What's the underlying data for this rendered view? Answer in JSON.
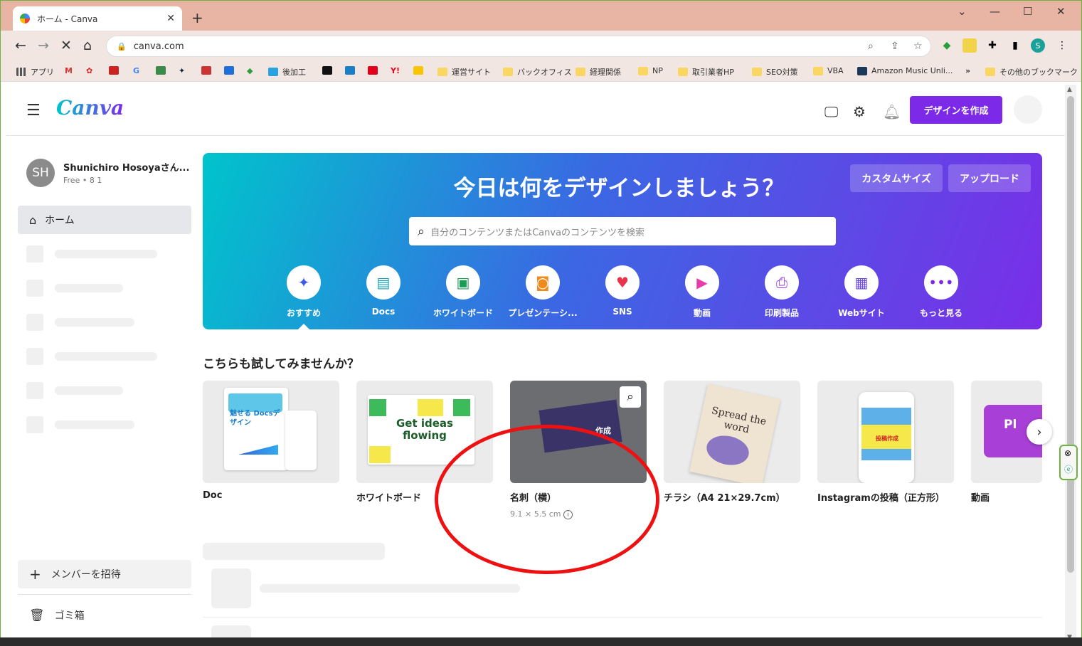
{
  "browser": {
    "tab_title": "ホーム - Canva",
    "url": "canva.com",
    "bookmarks": [
      {
        "label": "アプリ"
      },
      {
        "label": "後加工"
      },
      {
        "label": "運営サイト"
      },
      {
        "label": "バックオフィス"
      },
      {
        "label": "経理関係"
      },
      {
        "label": "NP"
      },
      {
        "label": "取引業者HP"
      },
      {
        "label": "SEO対策"
      },
      {
        "label": "VBA"
      },
      {
        "label": "Amazon Music Unli..."
      },
      {
        "label": "その他のブックマーク"
      }
    ],
    "profile_initial": "S"
  },
  "header": {
    "logo": "Canva",
    "create_button": "デザインを作成"
  },
  "sidebar": {
    "avatar_initials": "SH",
    "user_name": "Shunichiro Hosoyaさん...",
    "plan": "Free • 8 1",
    "home": "ホーム",
    "invite": "メンバーを招待",
    "trash": "ゴミ箱"
  },
  "hero": {
    "title": "今日は何をデザインしましょう？",
    "custom_size": "カスタムサイズ",
    "upload": "アップロード",
    "search_placeholder": "自分のコンテンツまたはCanvaのコンテンツを検索",
    "categories": [
      {
        "label": "おすすめ",
        "icon": "sparkle-icon",
        "color": "#3b5ce5"
      },
      {
        "label": "Docs",
        "icon": "docs-icon",
        "color": "#13a3b8"
      },
      {
        "label": "ホワイトボード",
        "icon": "whiteboard-icon",
        "color": "#1a9e55"
      },
      {
        "label": "プレゼンテーシ...",
        "icon": "presentation-icon",
        "color": "#f08a1c"
      },
      {
        "label": "SNS",
        "icon": "heart-icon",
        "color": "#e8344a"
      },
      {
        "label": "動画",
        "icon": "video-icon",
        "color": "#e83aa8"
      },
      {
        "label": "印刷製品",
        "icon": "printer-icon",
        "color": "#9b3ee8"
      },
      {
        "label": "Webサイト",
        "icon": "website-icon",
        "color": "#6a49e8"
      },
      {
        "label": "もっと見る",
        "icon": "more-icon",
        "color": "#7d2ae8"
      }
    ]
  },
  "section": {
    "title": "こちらも試してみませんか？",
    "cards": [
      {
        "title": "Doc",
        "thumb_text": "魅せる Docsデザイン"
      },
      {
        "title": "ホワイトボード",
        "thumb_text": "Get ideas flowing"
      },
      {
        "title": "名刺（横）",
        "size": "9.1 × 5.5 cm",
        "thumb_text": "作成"
      },
      {
        "title": "チラシ（A4 21×29.7cm）",
        "thumb_text": "Spread the word"
      },
      {
        "title": "Instagramの投稿（正方形）",
        "thumb_text": "投稿作成"
      },
      {
        "title": "動画",
        "thumb_text": "Pl"
      }
    ]
  }
}
